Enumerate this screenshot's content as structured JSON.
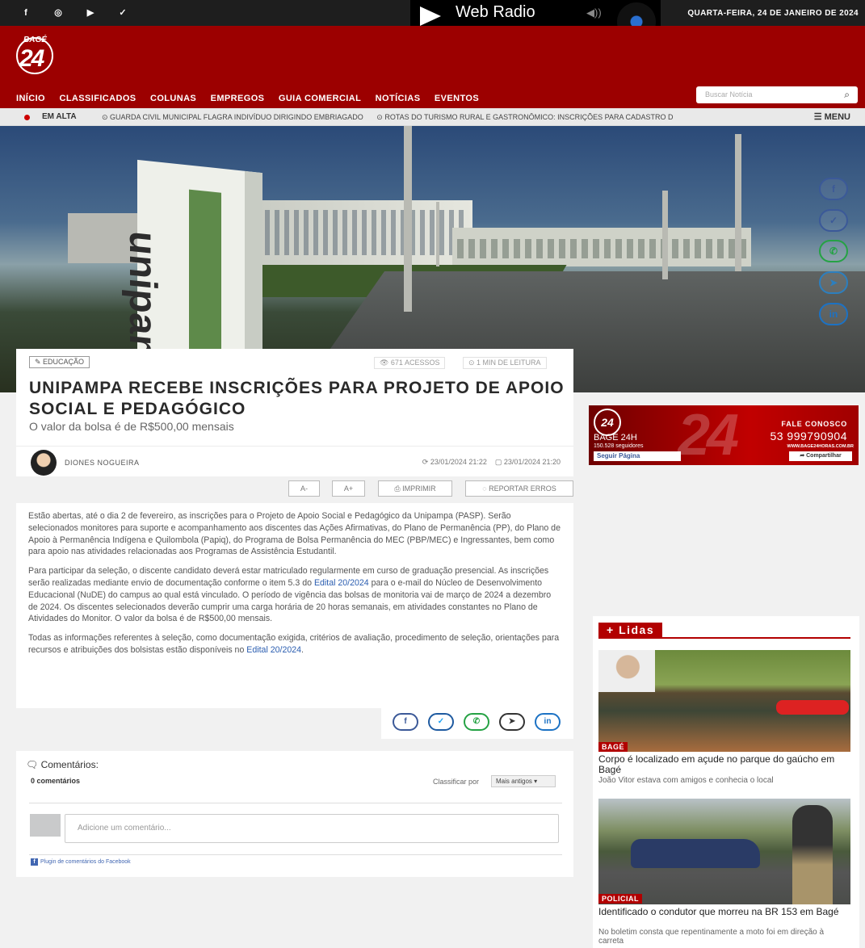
{
  "topbar": {
    "social": [
      {
        "icon": "facebook-icon",
        "glyph": "f"
      },
      {
        "icon": "instagram-icon",
        "glyph": "◎"
      },
      {
        "icon": "youtube-icon",
        "glyph": "▶"
      },
      {
        "icon": "twitter-icon",
        "glyph": "✓"
      }
    ],
    "radio_title": "Web Radio",
    "date": "QUARTA-FEIRA, 24 DE JANEIRO DE 2024"
  },
  "header": {
    "logo_top": "BAGÉ",
    "logo_num": "24",
    "nav": [
      "INÍCIO",
      "CLASSIFICADOS",
      "COLUNAS",
      "EMPREGOS",
      "GUIA COMERCIAL",
      "NOTÍCIAS",
      "EVENTOS"
    ],
    "search_placeholder": "Buscar Notícia"
  },
  "ticker": {
    "label": "EM ALTA",
    "items": [
      "⊙ GUARDA CIVIL MUNICIPAL FLAGRA INDIVÍDUO DIRIGINDO EMBRIAGADO",
      "⊙ ROTAS DO TURISMO RURAL E GASTRONÔMICO: INSCRIÇÕES PARA CADASTRO D"
    ],
    "menu": "☰ MENU"
  },
  "hero": {
    "sign_text": "unipampa"
  },
  "article": {
    "category": "✎ EDUCAÇÃO",
    "views": "👁 671 ACESSOS",
    "read_time": "⊙ 1 MIN DE LEITURA",
    "title": "UNIPAMPA RECEBE INSCRIÇÕES PARA PROJETO DE APOIO SOCIAL E PEDAGÓGICO",
    "subtitle": "O valor da bolsa é de R$500,00 mensais",
    "author": "DIONES NOGUEIRA",
    "updated": "⟳ 23/01/2024 21:22",
    "published": "▢ 23/01/2024 21:20",
    "tools": {
      "font_down": "A-",
      "font_up": "A+",
      "print": "⎙ IMPRIMIR",
      "report": "◌ REPORTAR ERROS"
    },
    "paragraphs": {
      "p1": "Estão abertas, até o dia 2 de fevereiro, as inscrições para o Projeto de Apoio Social e Pedagógico da Unipampa (PASP). Serão selecionados monitores para suporte e acompanhamento aos discentes das Ações Afirmativas, do Plano de Permanência (PP), do Plano de Apoio à Permanência Indígena e Quilombola (Papiq), do Programa de Bolsa Permanência do MEC (PBP/MEC) e Ingressantes, bem como para apoio nas atividades relacionadas aos Programas de Assistência Estudantil.",
      "p2_a": "Para participar da seleção, o discente candidato deverá estar matriculado regularmente em curso de graduação presencial. As inscrições serão realizadas mediante envio de documentação conforme o item 5.3 do ",
      "p2_link": "Edital 20/2024",
      "p2_b": " para o e-mail do Núcleo de Desenvolvimento Educacional (NuDE) do campus ao qual está vinculado. O período de vigência das bolsas de monitoria vai de março de 2024 a dezembro de 2024. Os discentes selecionados deverão cumprir uma carga horária de 20 horas semanais, em atividades constantes no Plano de Atividades do Monitor. O valor da bolsa é de R$500,00 mensais.",
      "p3_a": "Todas as informações referentes à seleção, como documentação exigida, critérios de avaliação, procedimento de seleção, orientações para recursos e atribuições dos bolsistas estão disponíveis no ",
      "p3_link": "Edital 20/2024",
      "p3_b": "."
    }
  },
  "share": {
    "facebook": "f",
    "twitter": "✓",
    "whatsapp": "✆",
    "telegram": "➤",
    "linkedin": "in"
  },
  "comments": {
    "title": "🗨 Comentários:",
    "count": "0 comentários",
    "sort_label": "Classificar por",
    "sort_value": "Mais antigos ▾",
    "placeholder": "Adicione um comentário...",
    "plugin": "Plugin de comentários do Facebook"
  },
  "banner": {
    "logo": "24",
    "big": "24",
    "name": "BAGÉ 24H",
    "followers": "150.528 seguidores",
    "follow": "Seguir Página",
    "contact": "FALE CONOSCO",
    "phone": "53 999790904",
    "url": "WWW.BAGE24HORAS.COM.BR",
    "share": "➦ Compartilhar"
  },
  "lidas": {
    "title": "+ Lidas",
    "items": [
      {
        "badge": "BAGÉ",
        "title": "Corpo é localizado em açude no parque do gaúcho em Bagé",
        "sub": "João Vitor estava com amigos e conhecia o local"
      },
      {
        "badge": "POLICIAL",
        "title": "Identificado o condutor que morreu na BR 153 em Bagé",
        "sub": "No boletim consta que repentinamente a moto foi em direção à carreta"
      }
    ]
  }
}
